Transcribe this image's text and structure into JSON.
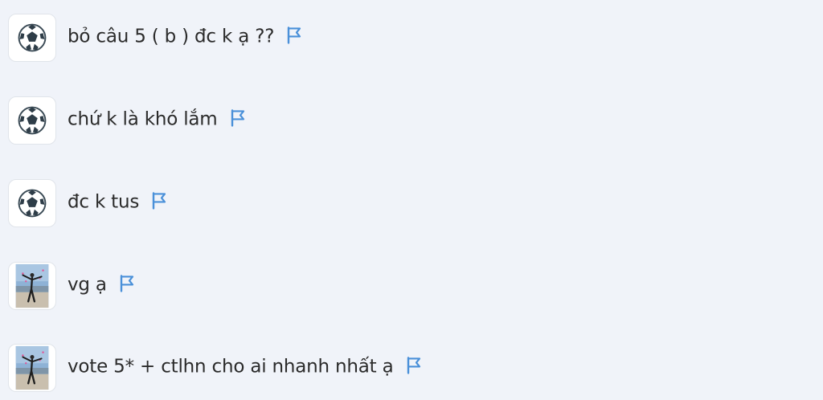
{
  "messages": [
    {
      "avatar_icon": "soccer-ball-icon",
      "text": "bỏ câu 5 ( b ) đc k ạ ??",
      "report_icon": "flag-icon"
    },
    {
      "avatar_icon": "soccer-ball-icon",
      "text": "chứ k là khó lắm",
      "report_icon": "flag-icon"
    },
    {
      "avatar_icon": "soccer-ball-icon",
      "text": "đc k tus",
      "report_icon": "flag-icon"
    },
    {
      "avatar_icon": "person-photo-avatar",
      "text": "vg ạ",
      "report_icon": "flag-icon"
    },
    {
      "avatar_icon": "person-photo-avatar",
      "text": "vote 5* + ctlhn cho ai nhanh nhất ạ",
      "report_icon": "flag-icon"
    }
  ],
  "colors": {
    "background": "#f0f3f9",
    "text": "#2b2b2b",
    "flag": "#4a90d9"
  }
}
